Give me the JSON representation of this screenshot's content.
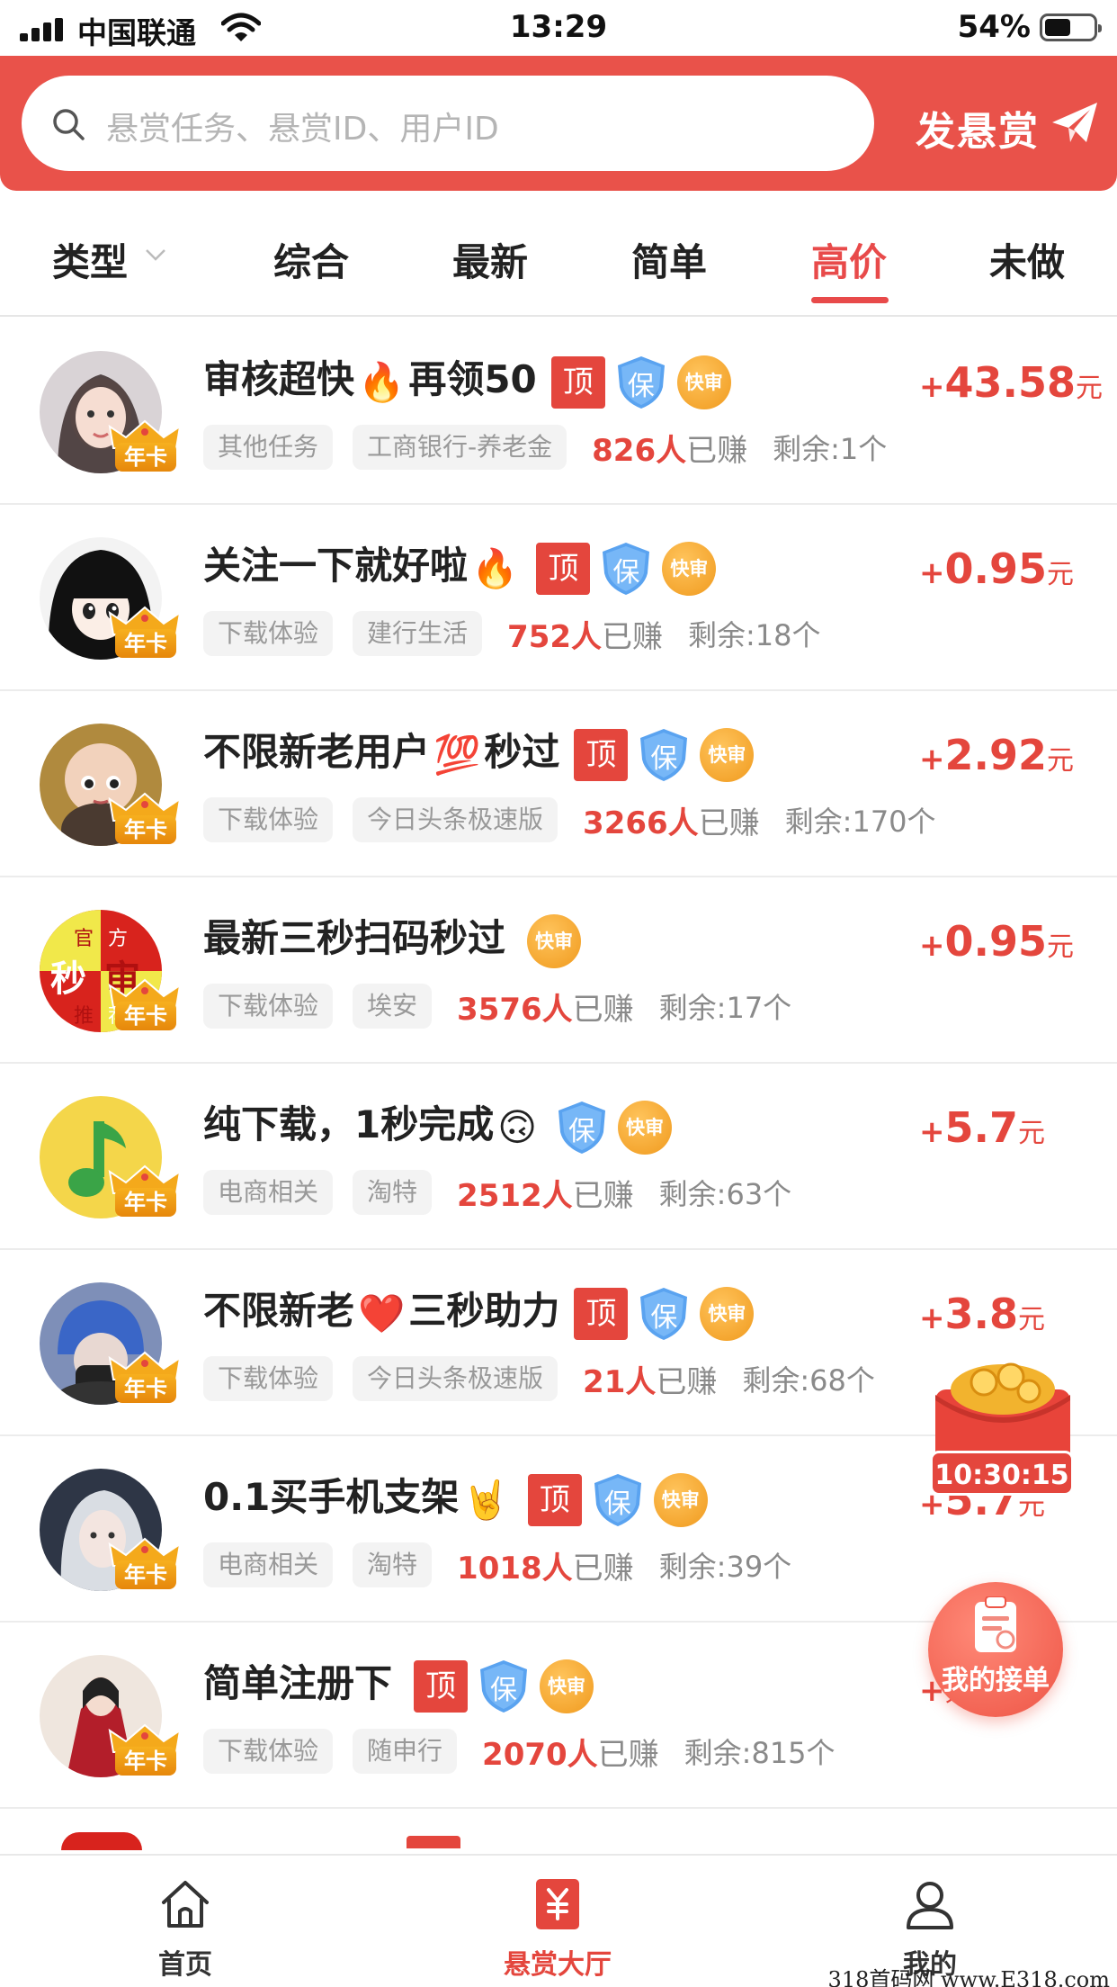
{
  "status_bar": {
    "carrier": "中国联通",
    "time": "13:29",
    "battery": "54%"
  },
  "header": {
    "search_placeholder": "悬赏任务、悬赏ID、用户ID",
    "post_label": "发悬赏"
  },
  "tabs": [
    {
      "label": "类型"
    },
    {
      "label": "综合"
    },
    {
      "label": "最新"
    },
    {
      "label": "简单"
    },
    {
      "label": "高价"
    },
    {
      "label": "未做"
    }
  ],
  "badges": {
    "top": "顶",
    "bao": "保",
    "fast": "快审",
    "card": "年卡"
  },
  "tasks": [
    {
      "title": "审核超快",
      "emoji": "🔥",
      "title_suffix": "再领50",
      "tags": [
        "其他任务",
        "工商银行-养老金"
      ],
      "earned_count": "826人",
      "earned_label": "已赚",
      "remaining": "剩余:1个",
      "reward_plus": "+",
      "reward": "43.58",
      "unit": "元"
    },
    {
      "title": "关注一下就好啦",
      "emoji": "🔥",
      "title_suffix": "",
      "tags": [
        "下载体验",
        "建行生活"
      ],
      "earned_count": "752人",
      "earned_label": "已赚",
      "remaining": "剩余:18个",
      "reward_plus": "+",
      "reward": "0.95",
      "unit": "元"
    },
    {
      "title": "不限新老用户",
      "emoji": "💯",
      "title_suffix": "秒过",
      "tags": [
        "下载体验",
        "今日头条极速版"
      ],
      "earned_count": "3266人",
      "earned_label": "已赚",
      "remaining": "剩余:170个",
      "reward_plus": "+",
      "reward": "2.92",
      "unit": "元"
    },
    {
      "title": "最新三秒扫码秒过",
      "emoji": "",
      "title_suffix": "",
      "tags": [
        "下载体验",
        "埃安"
      ],
      "earned_count": "3576人",
      "earned_label": "已赚",
      "remaining": "剩余:17个",
      "reward_plus": "+",
      "reward": "0.95",
      "unit": "元"
    },
    {
      "title": "纯下载，1秒完成",
      "emoji": "🙃",
      "title_suffix": "",
      "tags": [
        "电商相关",
        "淘特"
      ],
      "earned_count": "2512人",
      "earned_label": "已赚",
      "remaining": "剩余:63个",
      "reward_plus": "+",
      "reward": "5.7",
      "unit": "元"
    },
    {
      "title": "不限新老",
      "emoji": "❤️",
      "title_suffix": "三秒助力",
      "tags": [
        "下载体验",
        "今日头条极速版"
      ],
      "earned_count": "21人",
      "earned_label": "已赚",
      "remaining": "剩余:68个",
      "reward_plus": "+",
      "reward": "3.8",
      "unit": "元"
    },
    {
      "title": "0.1买手机支架",
      "emoji": "🤘",
      "title_suffix": "",
      "tags": [
        "电商相关",
        "淘特"
      ],
      "earned_count": "1018人",
      "earned_label": "已赚",
      "remaining": "剩余:39个",
      "reward_plus": "+",
      "reward": "5.7",
      "unit": "元"
    },
    {
      "title": "简单注册下",
      "emoji": "",
      "title_suffix": "",
      "tags": [
        "下载体验",
        "随申行"
      ],
      "earned_count": "2070人",
      "earned_label": "已赚",
      "remaining": "剩余:815个",
      "reward_plus": "+",
      "reward": "",
      "unit": "元"
    }
  ],
  "avatar4_text": [
    "官",
    "方",
    "秒",
    "审",
    "推",
    "荐"
  ],
  "floating": {
    "timer": "10:30:15",
    "my_orders": "我的接单"
  },
  "bottom_nav": [
    {
      "label": "首页",
      "icon": "home-icon"
    },
    {
      "label": "悬赏大厅",
      "icon": "reward-hall-icon"
    },
    {
      "label": "我的",
      "icon": "profile-icon"
    }
  ],
  "watermark": "318首码网 www.E318.com",
  "colors": {
    "brand_red": "#e9524a",
    "accent_red": "#e4463d",
    "fast_orange": "#f09a1e",
    "bao_blue": "#5aa3f0"
  }
}
